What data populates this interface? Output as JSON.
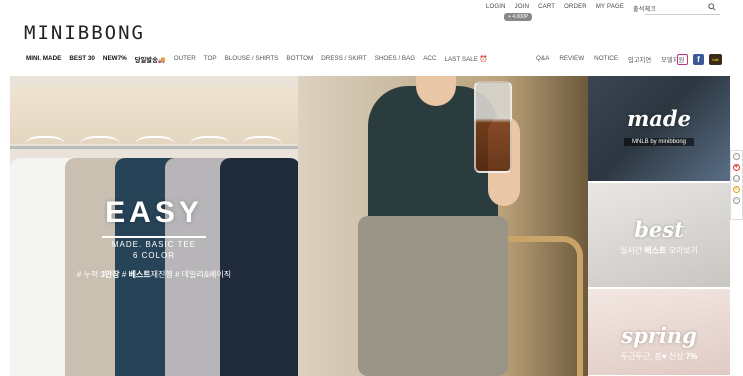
{
  "header": {
    "top_links": [
      "LOGIN",
      "JOIN",
      "CART",
      "ORDER",
      "MY PAGE",
      "출석체크"
    ],
    "search": {
      "placeholder": "",
      "value": "",
      "icon": "search-icon"
    },
    "coupon_badge": "+ 4,000P"
  },
  "logo": "MINIBBONG",
  "nav": {
    "left": [
      "MINI. MADE",
      "BEST 30",
      "NEW7%",
      "당일발송🚚",
      "OUTER",
      "TOP",
      "BLOUSE / SHIRTS",
      "BOTTOM",
      "DRESS / SKIRT",
      "SHOES / BAG",
      "ACC",
      "LAST SALE ⏰"
    ],
    "right": [
      "Q&A",
      "REVIEW",
      "NOTICE",
      "입고지연",
      "모델지원"
    ],
    "social": [
      "instagram-icon",
      "facebook-icon",
      "kakao-icon"
    ]
  },
  "main_banner": {
    "title": "EASY",
    "subtitle_line1": "MADE. BASIC TEE",
    "subtitle_line2": "6 COLOR",
    "tag1_prefix": "# 누적 ",
    "tag1_bold": "3만장",
    "tag2_prefix": " # ",
    "tag2_bold": "베스트",
    "tag2_suffix": "재진행",
    "tag3": " # 데일리&베이직"
  },
  "side_tiles": [
    {
      "title": "made",
      "sub": "MNLB by minibbong"
    },
    {
      "title": "best",
      "sub_prefix": "실시간 ",
      "sub_bold": "베스트",
      "sub_suffix": " 모아보기"
    },
    {
      "title": "spring",
      "sub_prefix": "두근두근, 봄♥ 신상 ",
      "sub_bold": "7%"
    }
  ],
  "quick_menu": [
    "minus-icon",
    "heart-icon",
    "cube-icon",
    "phone-icon",
    "minus-icon"
  ],
  "colors": {
    "accent": "#222222",
    "text_light": "#ffffff"
  }
}
